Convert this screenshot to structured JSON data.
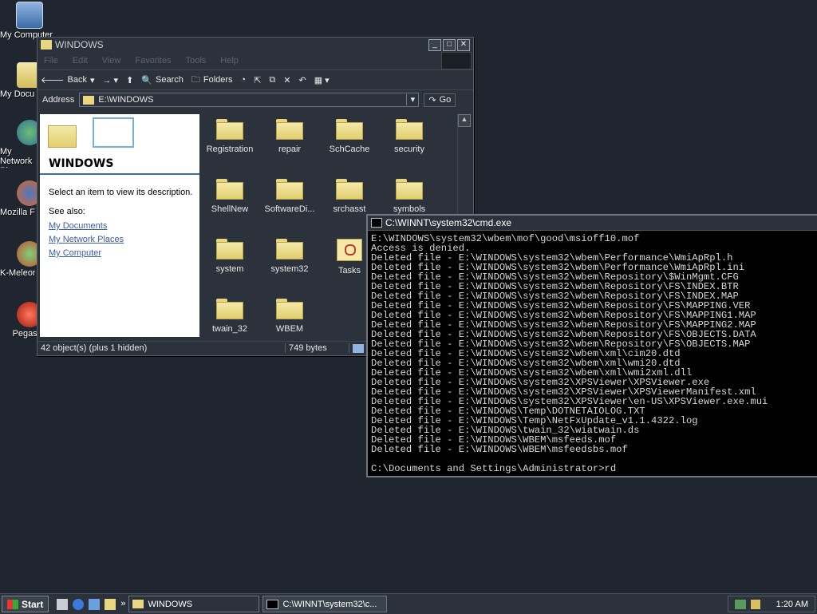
{
  "desktop": {
    "icons": [
      {
        "label": "My Computer",
        "icon": "my-computer-icon"
      },
      {
        "label": "My Documents",
        "icon": "my-documents-icon"
      },
      {
        "label": "My Network Places",
        "icon": "network-places-icon"
      },
      {
        "label": "Mozilla Firefox",
        "icon": "firefox-icon"
      },
      {
        "label": "K-Meleon",
        "icon": "k-meleon-icon"
      },
      {
        "label": "Pegasus",
        "icon": "pegasus-icon"
      }
    ]
  },
  "explorer": {
    "title": "WINDOWS",
    "menu": [
      "File",
      "Edit",
      "View",
      "Favorites",
      "Tools",
      "Help"
    ],
    "toolbar": {
      "back": "Back",
      "search": "Search",
      "folders": "Folders"
    },
    "address_label": "Address",
    "address_value": "E:\\WINDOWS",
    "go": "Go",
    "panel": {
      "title": "WINDOWS",
      "desc": "Select an item to view its description.",
      "see_also": "See also:",
      "links": [
        "My Documents",
        "My Network Places",
        "My Computer"
      ]
    },
    "folders": [
      "Registration",
      "repair",
      "SchCache",
      "security",
      "ShellNew",
      "SoftwareDi...",
      "srchasst",
      "symbols",
      "system",
      "system32",
      "Tasks",
      "twain_32",
      "WBEM"
    ],
    "status": {
      "objects": "42 object(s) (plus 1 hidden)",
      "size": "749 bytes"
    }
  },
  "cmd": {
    "title": "C:\\WINNT\\system32\\cmd.exe",
    "lines": [
      "E:\\WINDOWS\\system32\\wbem\\mof\\good\\msioff10.mof",
      "Access is denied.",
      "Deleted file - E:\\WINDOWS\\system32\\wbem\\Performance\\WmiApRpl.h",
      "Deleted file - E:\\WINDOWS\\system32\\wbem\\Performance\\WmiApRpl.ini",
      "Deleted file - E:\\WINDOWS\\system32\\wbem\\Repository\\$WinMgmt.CFG",
      "Deleted file - E:\\WINDOWS\\system32\\wbem\\Repository\\FS\\INDEX.BTR",
      "Deleted file - E:\\WINDOWS\\system32\\wbem\\Repository\\FS\\INDEX.MAP",
      "Deleted file - E:\\WINDOWS\\system32\\wbem\\Repository\\FS\\MAPPING.VER",
      "Deleted file - E:\\WINDOWS\\system32\\wbem\\Repository\\FS\\MAPPING1.MAP",
      "Deleted file - E:\\WINDOWS\\system32\\wbem\\Repository\\FS\\MAPPING2.MAP",
      "Deleted file - E:\\WINDOWS\\system32\\wbem\\Repository\\FS\\OBJECTS.DATA",
      "Deleted file - E:\\WINDOWS\\system32\\wbem\\Repository\\FS\\OBJECTS.MAP",
      "Deleted file - E:\\WINDOWS\\system32\\wbem\\xml\\cim20.dtd",
      "Deleted file - E:\\WINDOWS\\system32\\wbem\\xml\\wmi20.dtd",
      "Deleted file - E:\\WINDOWS\\system32\\wbem\\xml\\wmi2xml.dll",
      "Deleted file - E:\\WINDOWS\\system32\\XPSViewer\\XPSViewer.exe",
      "Deleted file - E:\\WINDOWS\\system32\\XPSViewer\\XPSViewerManifest.xml",
      "Deleted file - E:\\WINDOWS\\system32\\XPSViewer\\en-US\\XPSViewer.exe.mui",
      "Deleted file - E:\\WINDOWS\\Temp\\DOTNETAIOLOG.TXT",
      "Deleted file - E:\\WINDOWS\\Temp\\NetFxUpdate_v1.1.4322.log",
      "Deleted file - E:\\WINDOWS\\twain_32\\wiatwain.ds",
      "Deleted file - E:\\WINDOWS\\WBEM\\msfeeds.mof",
      "Deleted file - E:\\WINDOWS\\WBEM\\msfeedsbs.mof",
      "",
      "C:\\Documents and Settings\\Administrator>rd"
    ]
  },
  "taskbar": {
    "start": "Start",
    "tasks": [
      "WINDOWS",
      "C:\\WINNT\\system32\\c..."
    ],
    "clock": "1:20 AM"
  }
}
